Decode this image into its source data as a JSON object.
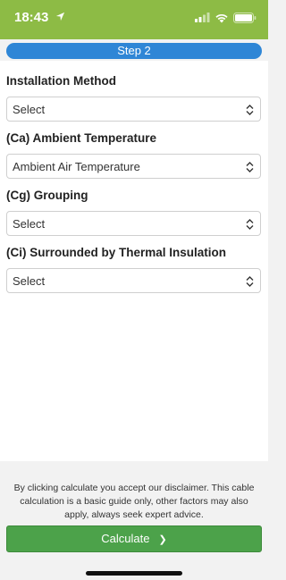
{
  "status_bar": {
    "time": "18:43",
    "icons": [
      "location-arrow-icon",
      "signal-icon",
      "wifi-icon",
      "battery-icon"
    ]
  },
  "step": {
    "label": "Step 2"
  },
  "fields": [
    {
      "label": "Installation Method",
      "value": "Select"
    },
    {
      "label": "(Ca) Ambient Temperature",
      "value": "Ambient Air Temperature"
    },
    {
      "label": "(Cg) Grouping",
      "value": "Select"
    },
    {
      "label": "(Ci) Surrounded by Thermal Insulation",
      "value": "Select"
    }
  ],
  "footer": {
    "disclaimer": "By clicking calculate you accept our disclaimer. This cable calculation is a basic guide only, other factors may also apply, always seek expert advice.",
    "calculate_label": "Calculate",
    "calculate_arrow": "❯"
  },
  "colors": {
    "status_bar_bg": "#8dbb45",
    "step_bar_bg": "#2f86d6",
    "calculate_bg": "#4ca24a"
  }
}
